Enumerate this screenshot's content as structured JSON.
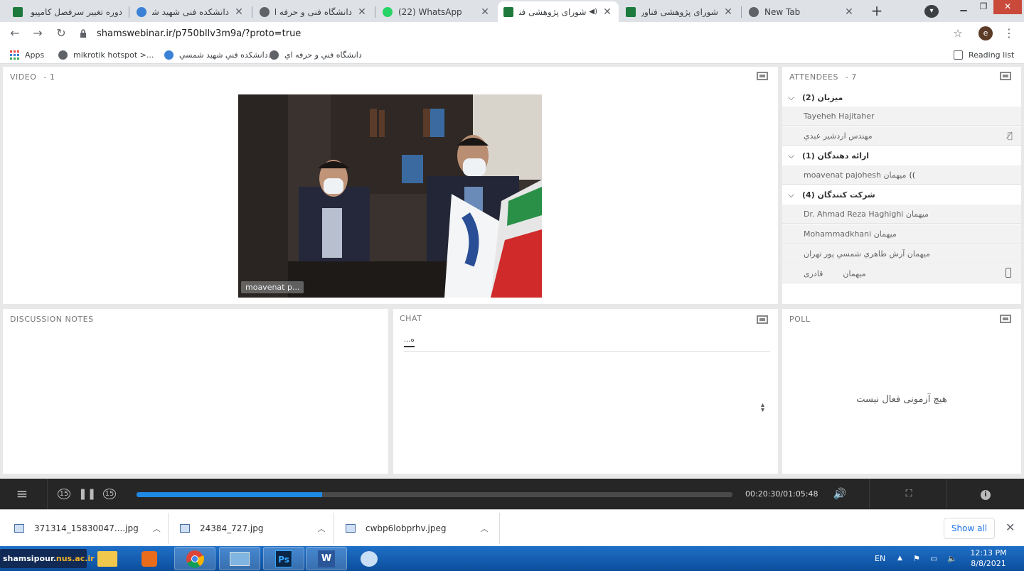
{
  "browser": {
    "tabs": [
      {
        "title": "دوره تغییر سرفصل کامپیو",
        "favicon": "green"
      },
      {
        "title": "دانشکده فنی شهید شمسی پ",
        "favicon": "blue"
      },
      {
        "title": "دانشگاه فنی و حرفه ای",
        "favicon": "gray"
      },
      {
        "title": "(22) WhatsApp",
        "favicon": "whatsapp"
      },
      {
        "title": "شورای پژوهشی فناو",
        "favicon": "green",
        "active": true
      },
      {
        "title": "شورای پژوهشی فناوری",
        "favicon": "green"
      },
      {
        "title": "New Tab",
        "favicon": "chrome"
      }
    ],
    "url": "shamswebinar.ir/p750bllv3m9a/?proto=true",
    "avatar_letter": "e",
    "bookmarks": [
      {
        "label": "Apps"
      },
      {
        "label": "mikrotik hotspot >..."
      },
      {
        "label": "دانشكده فني شهيد شمسي..."
      },
      {
        "label": "دانشگاه فني و حرفه اي"
      }
    ],
    "reading_list": "Reading list"
  },
  "video": {
    "title": "VIDEO",
    "count": "- 1",
    "participant_label": "moavenat p..."
  },
  "attendees": {
    "title": "ATTENDEES",
    "count": "- 7",
    "groups": [
      {
        "label": "میزبان (2)",
        "members": [
          {
            "name": "Tayeheh Hajitaher"
          },
          {
            "name": "مهندس اردشير عبدي",
            "icon": "mic-muted-icon"
          }
        ]
      },
      {
        "label": "ارائه دهندگان (1)",
        "members": [
          {
            "name": "moavenat pajohesh میهمان",
            "icon": "speaking-icon"
          }
        ]
      },
      {
        "label": "شرکت کنندگان (4)",
        "members": [
          {
            "name": "Dr. Ahmad Reza Haghighi میهمان"
          },
          {
            "name": "Mohammadkhani میهمان"
          },
          {
            "name": "میهمان آرش طاهري شمسي پور تهران"
          },
          {
            "name": "میهمان        قادری",
            "icon": "mobile-icon"
          }
        ]
      }
    ]
  },
  "notes": {
    "title": "DISCUSSION NOTES"
  },
  "chat": {
    "title": "CHAT",
    "tab": "...ه"
  },
  "poll": {
    "title": "POLL",
    "empty_text": "هیچ آزمونی فعال نیست"
  },
  "player": {
    "rewind": "15",
    "forward": "15",
    "time": "00:20:30/01:05:48",
    "progress": 0.312
  },
  "downloads": {
    "items": [
      {
        "name": "371314_15830047....jpg"
      },
      {
        "name": "24384_727.jpg"
      },
      {
        "name": "cwbp6lobprhv.jpeg"
      }
    ],
    "show_all": "Show all"
  },
  "taskbar": {
    "start_text": "shamsipour.",
    "start_accent": "nus.ac.ir",
    "lang": "EN",
    "time": "12:13 PM",
    "date": "8/8/2021"
  }
}
